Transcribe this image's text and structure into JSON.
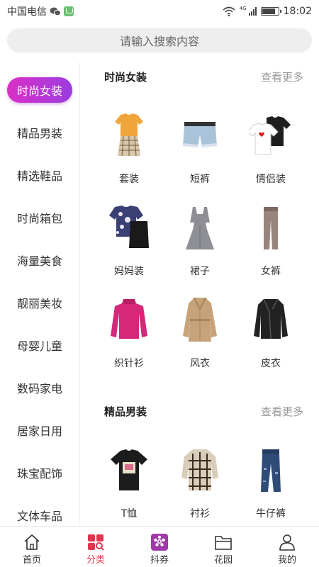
{
  "status_bar": {
    "carrier": "中国电信",
    "network": "4G",
    "time": "18:02",
    "battery_level": 0.85
  },
  "search": {
    "placeholder": "请输入搜索内容"
  },
  "sidebar": {
    "active_color": "#c336d0",
    "items": [
      {
        "label": "时尚女装",
        "active": true
      },
      {
        "label": "精品男装"
      },
      {
        "label": "精选鞋品"
      },
      {
        "label": "时尚箱包"
      },
      {
        "label": "海量美食"
      },
      {
        "label": "靓丽美妆"
      },
      {
        "label": "母婴儿童"
      },
      {
        "label": "数码家电"
      },
      {
        "label": "居家日用"
      },
      {
        "label": "珠宝配饰"
      },
      {
        "label": "文体车品"
      }
    ]
  },
  "sections": [
    {
      "title": "时尚女装",
      "more": "查看更多",
      "items": [
        {
          "label": "套装",
          "icon": "outfit-set-icon"
        },
        {
          "label": "短裤",
          "icon": "denim-shorts-icon"
        },
        {
          "label": "情侣装",
          "icon": "couple-tshirts-icon"
        },
        {
          "label": "妈妈装",
          "icon": "mom-outfit-icon"
        },
        {
          "label": "裙子",
          "icon": "dress-icon"
        },
        {
          "label": "女裤",
          "icon": "women-pants-icon"
        },
        {
          "label": "织针衫",
          "icon": "knit-sweater-icon"
        },
        {
          "label": "风衣",
          "icon": "trench-coat-icon"
        },
        {
          "label": "皮衣",
          "icon": "leather-jacket-icon"
        }
      ]
    },
    {
      "title": "精品男装",
      "more": "查看更多",
      "items": [
        {
          "label": "T恤",
          "icon": "tshirt-icon"
        },
        {
          "label": "衬衫",
          "icon": "plaid-shirt-icon"
        },
        {
          "label": "牛仔裤",
          "icon": "jeans-icon"
        }
      ]
    }
  ],
  "bottom_nav": {
    "active_color": "#e0374f",
    "items": [
      {
        "label": "首页",
        "icon": "home-icon"
      },
      {
        "label": "分类",
        "icon": "category-icon",
        "active": true
      },
      {
        "label": "抖券",
        "icon": "coupon-icon"
      },
      {
        "label": "花园",
        "icon": "folder-icon"
      },
      {
        "label": "我的",
        "icon": "profile-icon"
      }
    ]
  }
}
